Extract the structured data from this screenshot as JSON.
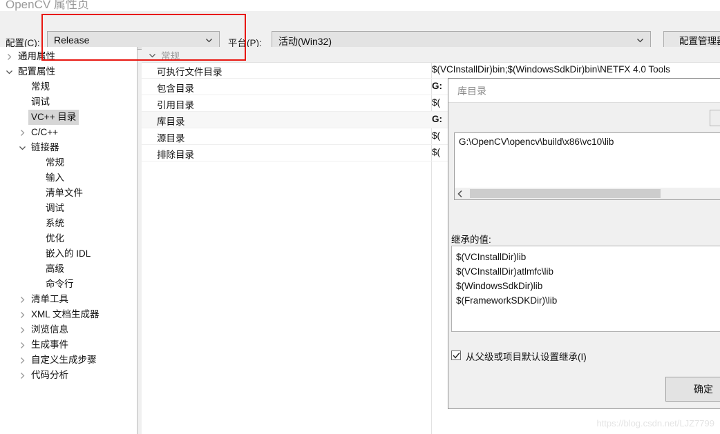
{
  "window": {
    "title": "OpenCV 属性页"
  },
  "configbar": {
    "config_label": "配置(C):",
    "config_value": "Release",
    "platform_label": "平台(P):",
    "platform_value": "活动(Win32)",
    "config_manager_button": "配置管理器("
  },
  "tree": {
    "items": [
      {
        "label": "通用属性",
        "indent": 0,
        "twisty": "collapsed",
        "selected": false
      },
      {
        "label": "配置属性",
        "indent": 0,
        "twisty": "expanded",
        "selected": false
      },
      {
        "label": "常规",
        "indent": 1,
        "twisty": "none",
        "selected": false
      },
      {
        "label": "调试",
        "indent": 1,
        "twisty": "none",
        "selected": false
      },
      {
        "label": "VC++ 目录",
        "indent": 1,
        "twisty": "none",
        "selected": true
      },
      {
        "label": "C/C++",
        "indent": 1,
        "twisty": "collapsed",
        "selected": false
      },
      {
        "label": "链接器",
        "indent": 1,
        "twisty": "expanded",
        "selected": false
      },
      {
        "label": "常规",
        "indent": 2,
        "twisty": "none",
        "selected": false
      },
      {
        "label": "输入",
        "indent": 2,
        "twisty": "none",
        "selected": false
      },
      {
        "label": "清单文件",
        "indent": 2,
        "twisty": "none",
        "selected": false
      },
      {
        "label": "调试",
        "indent": 2,
        "twisty": "none",
        "selected": false
      },
      {
        "label": "系统",
        "indent": 2,
        "twisty": "none",
        "selected": false
      },
      {
        "label": "优化",
        "indent": 2,
        "twisty": "none",
        "selected": false
      },
      {
        "label": "嵌入的 IDL",
        "indent": 2,
        "twisty": "none",
        "selected": false
      },
      {
        "label": "高级",
        "indent": 2,
        "twisty": "none",
        "selected": false
      },
      {
        "label": "命令行",
        "indent": 2,
        "twisty": "none",
        "selected": false
      },
      {
        "label": "清单工具",
        "indent": 1,
        "twisty": "collapsed",
        "selected": false
      },
      {
        "label": "XML 文档生成器",
        "indent": 1,
        "twisty": "collapsed",
        "selected": false
      },
      {
        "label": "浏览信息",
        "indent": 1,
        "twisty": "collapsed",
        "selected": false
      },
      {
        "label": "生成事件",
        "indent": 1,
        "twisty": "collapsed",
        "selected": false
      },
      {
        "label": "自定义生成步骤",
        "indent": 1,
        "twisty": "collapsed",
        "selected": false
      },
      {
        "label": "代码分析",
        "indent": 1,
        "twisty": "collapsed",
        "selected": false
      }
    ]
  },
  "grid": {
    "category": "常规",
    "rows": [
      {
        "name": "可执行文件目录",
        "value": "$(VCInstallDir)bin;$(WindowsSdkDir)bin\\NETFX 4.0 Tools",
        "bold": false
      },
      {
        "name": "包含目录",
        "value": "G:",
        "bold": true
      },
      {
        "name": "引用目录",
        "value": "$(",
        "bold": false
      },
      {
        "name": "库目录",
        "value": "G:",
        "bold": true
      },
      {
        "name": "源目录",
        "value": "$(",
        "bold": false
      },
      {
        "name": "排除目录",
        "value": "$(",
        "bold": false
      }
    ]
  },
  "popup": {
    "title": "库目录",
    "entries": [
      "G:\\OpenCV\\opencv\\build\\x86\\vc10\\lib"
    ],
    "inherited_label": "继承的值:",
    "inherited_values": [
      "$(VCInstallDir)lib",
      "$(VCInstallDir)atlmfc\\lib",
      "$(WindowsSdkDir)lib",
      "$(FrameworkSDKDir)\\lib"
    ],
    "inherit_checkbox_label": "从父级或项目默认设置继承(I)",
    "inherit_checkbox_checked": true,
    "ok_button": "确定"
  },
  "watermark": {
    "text": "https://blog.csdn.net/LJZ7799"
  },
  "colors": {
    "annotation": "#e8160f",
    "selection": "#d6d6d6",
    "category_text": "#9a9a9a"
  }
}
